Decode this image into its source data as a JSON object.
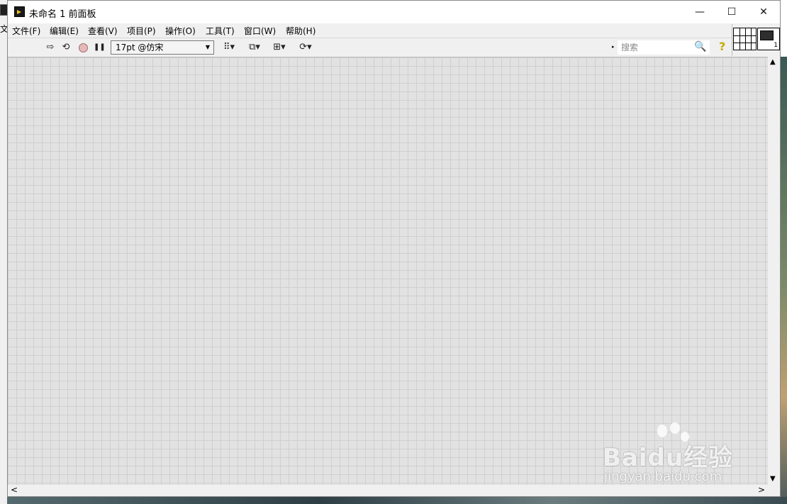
{
  "window": {
    "title": "未命名 1 前面板"
  },
  "window_buttons": {
    "minimize": "—",
    "maximize": "☐",
    "close": "✕"
  },
  "background": {
    "window_label": "文"
  },
  "menu": [
    {
      "label": "文件(F)"
    },
    {
      "label": "编辑(E)"
    },
    {
      "label": "查看(V)"
    },
    {
      "label": "项目(P)"
    },
    {
      "label": "操作(O)"
    },
    {
      "label": "工具(T)"
    },
    {
      "label": "窗口(W)"
    },
    {
      "label": "帮助(H)"
    }
  ],
  "toolbar": {
    "run_icon": "⇨",
    "run_continuous_icon": "⟲",
    "pause_icon": "❚❚",
    "font_value": "17pt @仿宋",
    "dropdown_arrow": "▼",
    "align_icon": "⠿▾",
    "distribute_icon": "⧉▾",
    "resize_icon": "⊞▾",
    "reorder_icon": "⟳▾",
    "search_placeholder": "搜索",
    "search_icon": "🔍",
    "help_icon": "?",
    "search_marker": "▸"
  },
  "vi_icon": {
    "number": "1"
  },
  "scroll": {
    "up": "▲",
    "down": "▼",
    "left": "<",
    "right": ">"
  },
  "watermark": {
    "brand": "Baidu经验",
    "url": "jingyan.baidu.com"
  }
}
